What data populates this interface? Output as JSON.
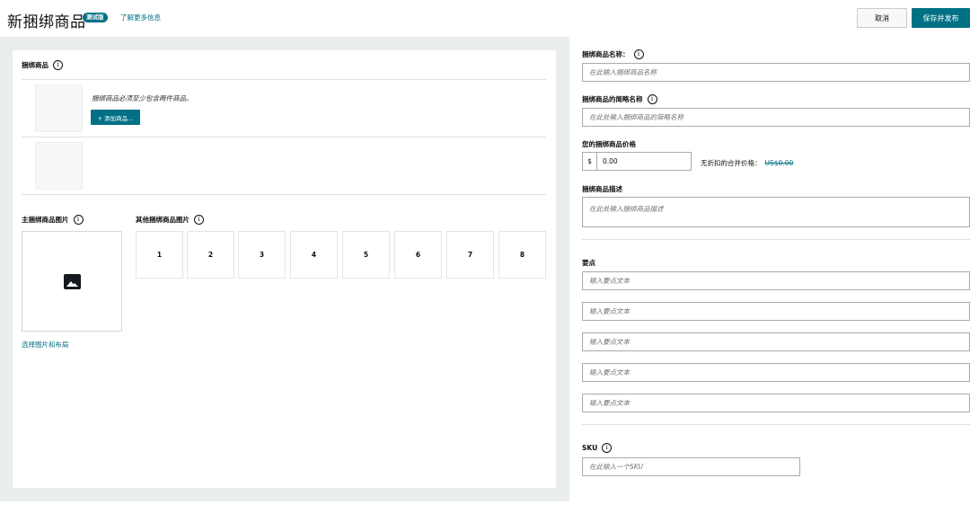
{
  "header": {
    "title": "新捆绑商品",
    "badge": "测试版",
    "learn_more": "了解更多信息",
    "cancel": "取消",
    "save_publish": "保存并发布"
  },
  "bundle": {
    "section_label": "捆绑商品",
    "hint": "捆绑商品必须至少包含两件商品。",
    "add_button": "+ 添加商品..."
  },
  "images": {
    "main_label": "主捆绑商品图片",
    "other_label": "其他捆绑商品图片",
    "slots": [
      "1",
      "2",
      "3",
      "4",
      "5",
      "6",
      "7",
      "8"
    ],
    "choose_link": "选择图片和布局"
  },
  "form": {
    "name_label": "捆绑商品名称：",
    "name_placeholder": "在此输入捆绑商品名称",
    "short_name_label": "捆绑商品的简略名称",
    "short_name_placeholder": "在此处输入捆绑商品的简略名称",
    "price_label": "您的捆绑商品价格",
    "currency_symbol": "$",
    "price_value": "0.00",
    "combined_price_label": "无折扣的合并价格：",
    "combined_price_value": "US$0.00",
    "description_label": "捆绑商品描述",
    "description_placeholder": "在此处输入捆绑商品描述",
    "bullets_label": "要点",
    "bullets": [
      "输入要点文本",
      "输入要点文本",
      "输入要点文本",
      "输入要点文本",
      "输入要点文本"
    ],
    "sku_label": "SKU",
    "sku_placeholder": "在此输入一个SKU"
  },
  "icons": {
    "info": "info-icon",
    "image_placeholder": "image-icon"
  },
  "colors": {
    "accent": "#007185",
    "background": "#e9eded"
  }
}
